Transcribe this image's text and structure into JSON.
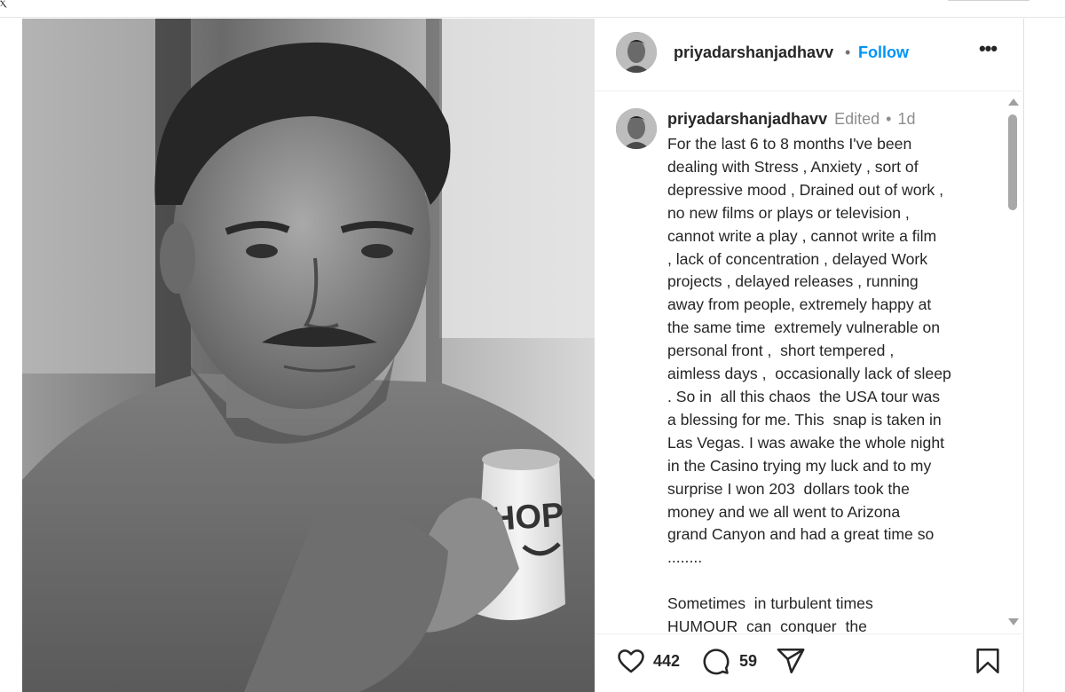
{
  "topbar": {
    "edge_glyph": "ⲭ"
  },
  "post": {
    "image": {
      "subject": "man holding coffee mug",
      "mug_logo_text": "IHOP"
    },
    "author": {
      "username": "priyadarshanjadhavv",
      "separator": "•",
      "follow_label": "Follow"
    },
    "more_label": "•••",
    "caption": {
      "username": "priyadarshanjadhavv",
      "edited_label": "Edited",
      "separator": "•",
      "timestamp": "1d",
      "lines": [
        "For the last 6 to 8 months I've been",
        "dealing with Stress , Anxiety , sort of",
        "depressive mood , Drained out of work ,",
        "no new films or plays or television ,",
        "cannot write a play , cannot write a film",
        ", lack of concentration , delayed Work",
        "projects , delayed releases , running",
        "away from people, extremely happy at",
        "the same time  extremely vulnerable on",
        "personal front ,  short tempered ,",
        "aimless days ,  occasionally lack of sleep",
        ". So in  all this chaos  the USA tour was",
        "a blessing for me. This  snap is taken in",
        "Las Vegas. I was awake the whole night",
        "in the Casino trying my luck and to my",
        "surprise I won 203  dollars took the",
        "money and we all went to Arizona",
        "grand Canyon and had a great time so",
        "........",
        "",
        "Sometimes  in turbulent times",
        "HUMOUR  can  conquer  the"
      ]
    },
    "likes_count": "442",
    "comments_count": "59"
  },
  "icons": {
    "like": "heart-icon",
    "comment": "comment-bubble-icon",
    "share": "paper-plane-icon",
    "save": "bookmark-icon",
    "more": "more-options-icon"
  },
  "colors": {
    "follow": "#0095f6",
    "text": "#262626",
    "secondary": "#8e8e8e",
    "scrollbar_thumb": "#a8a8a8"
  }
}
